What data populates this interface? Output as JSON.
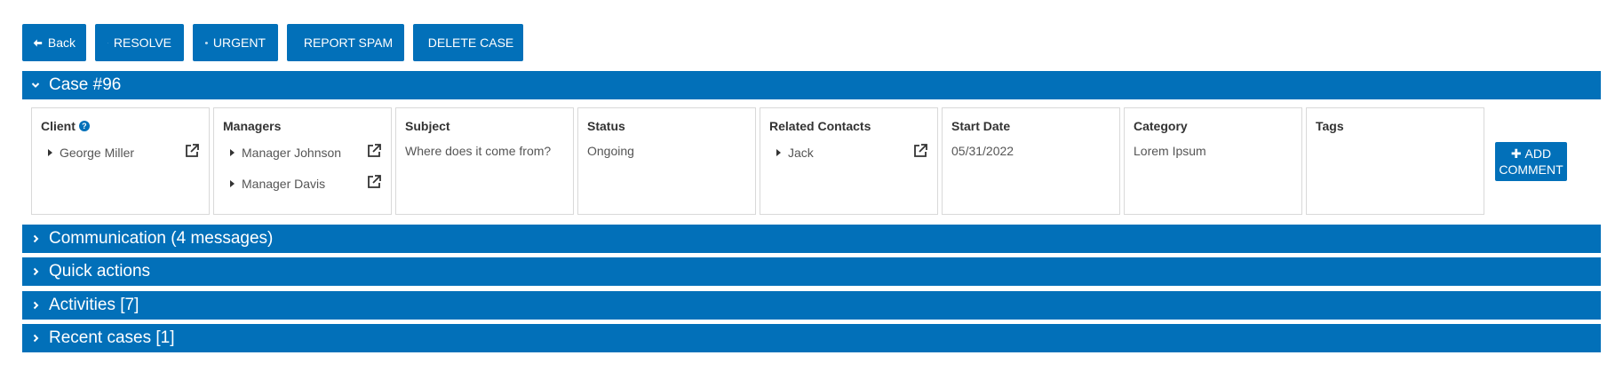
{
  "toolbar": {
    "back": "Back",
    "resolve": "RESOLVE",
    "urgent": "URGENT",
    "report_spam": "REPORT SPAM",
    "delete_case": "DELETE CASE"
  },
  "case_panel": {
    "title": "Case #96",
    "client": {
      "label": "Client",
      "name": "George Miller"
    },
    "managers": {
      "label": "Managers",
      "items": [
        "Manager Johnson",
        "Manager Davis"
      ]
    },
    "subject": {
      "label": "Subject",
      "value": "Where does it come from?"
    },
    "status": {
      "label": "Status",
      "value": "Ongoing"
    },
    "related_contacts": {
      "label": "Related Contacts",
      "items": [
        "Jack"
      ]
    },
    "start_date": {
      "label": "Start Date",
      "value": "05/31/2022"
    },
    "category": {
      "label": "Category",
      "value": "Lorem Ipsum"
    },
    "tags": {
      "label": "Tags",
      "value": ""
    },
    "add_comment_line1": "ADD",
    "add_comment_line2": "COMMENT"
  },
  "sections": [
    {
      "title": "Communication (4 messages)"
    },
    {
      "title": "Quick actions"
    },
    {
      "title": "Activities [7]"
    },
    {
      "title": "Recent cases [1]"
    }
  ],
  "colors": {
    "primary": "#0270b9"
  }
}
